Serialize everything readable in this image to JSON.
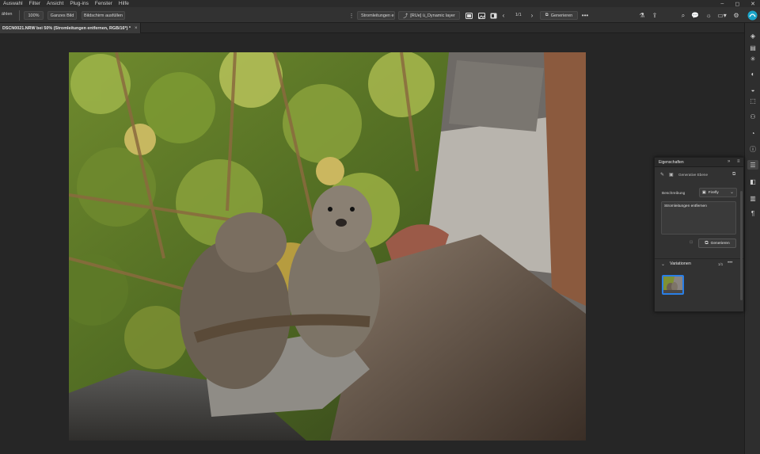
{
  "menu": {
    "items": [
      "Auswahl",
      "Filter",
      "Ansicht",
      "Plug-ins",
      "Fenster",
      "Hilfe"
    ],
    "window_controls": [
      "–",
      "◻",
      "✕"
    ]
  },
  "options_bar": {
    "left_label": "ählen",
    "zoom": "100%",
    "fit_screen": "Ganzes Bild",
    "fill_screen": "Bildschirm ausfüllen",
    "prompt_chip": "Stromleitungen e",
    "layer_chip": "[RUe] ü_Dynamic layer",
    "page_counter": "1/1",
    "generate_label": "Generieren",
    "more": "•••"
  },
  "document": {
    "tab_title": "DSCN0021.NRW bei 50% (Stromleitungen entfernen, RGB/16*) *",
    "close": "×"
  },
  "properties_panel": {
    "title": "Eigenschaften",
    "genfill_label": "Generative Ebene",
    "description_label": "Beschreibung",
    "model_select": "Firefly",
    "prompt_value": "Stromleitungen entfernen",
    "generate_label": "Generieren",
    "variations_label": "Variationen",
    "variations_count": "1/1",
    "more": "•••"
  },
  "colors": {
    "accent": "#2a7fe6",
    "panel_bg": "#323232",
    "canvas_bg": "#262626"
  }
}
